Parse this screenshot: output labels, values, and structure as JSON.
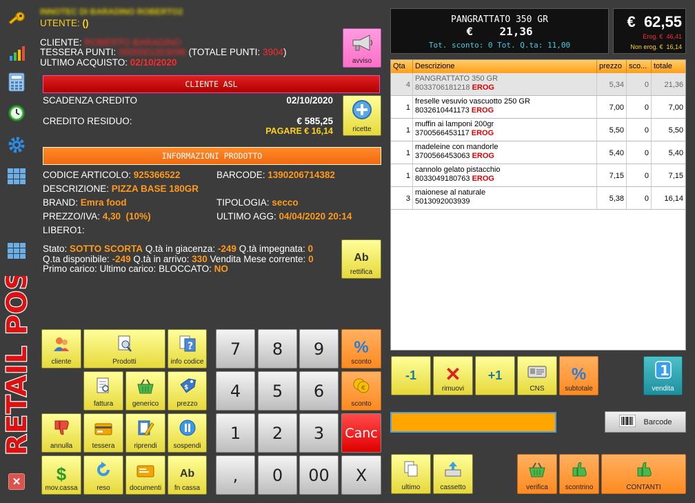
{
  "sidebar": {
    "icons": [
      "key-icon",
      "chart-icon",
      "calculator-icon",
      "clock-icon",
      "gear-icon",
      "grid-icon",
      "grid-icon"
    ],
    "logo_text": "RETAIL POS",
    "close_label": "✕"
  },
  "header": {
    "store_name": "INNOTEC DI BARADINO ROBERTO2",
    "utente_label": "UTENTE:",
    "utente_value": "()"
  },
  "customer": {
    "cliente_label": "CLIENTE:",
    "cliente_value": "ROBERTO BARADINO",
    "tessera_label": "TESSERA PUNTI:",
    "tessera_value": "0000001003096",
    "totale_punti_label": "(TOTALE PUNTI:",
    "totale_punti_value": "3904",
    "totale_punti_close": ")",
    "ultimo_acquisto_label": "ULTIMO ACQUISTO:",
    "ultimo_acquisto_value": "02/10/2020"
  },
  "avviso_button": "avviso",
  "asl_bar": "CLIENTE ASL",
  "credit": {
    "scadenza_label": "SCADENZA CREDITO",
    "scadenza_value": "02/10/2020",
    "residuo_label": "CREDITO RESIDUO:",
    "residuo_value": "€ 585,25",
    "pagare_value": "PAGARE € 16,14"
  },
  "ricette_button": "ricette",
  "product_bar": "INFORMAZIONI PRODOTTO",
  "product": {
    "codice_label": "CODICE ARTICOLO:",
    "codice_value": "925366522",
    "barcode_label": "BARCODE:",
    "barcode_value": "1390206714382",
    "descrizione_label": "DESCRIZIONE:",
    "descrizione_value": "PIZZA BASE 180GR",
    "brand_label": "BRAND:",
    "brand_value": "Emra food",
    "tipologia_label": "TIPOLOGIA:",
    "tipologia_value": "secco",
    "prezzo_label": "PREZZO/IVA:",
    "prezzo_value": "4,30  (10%)",
    "ultimo_agg_label": "ULTIMO AGG:",
    "ultimo_agg_value": "04/04/2020 20:14",
    "libero_label": "LIBERO1:"
  },
  "stock": {
    "stato_label": "Stato:",
    "stato_value": "SOTTO SCORTA",
    "giacenza_label": "Q.tà in giacenza:",
    "giacenza_value": "-249",
    "impegnata_label": "Q.tà impegnata:",
    "impegnata_value": "0",
    "disponibile_label": "Q.ta disponibile:",
    "disponibile_value": "-249",
    "arrivo_label": "Q.tà in arrivo:",
    "arrivo_value": "330",
    "vendita_label": "Vendita Mese corrente:",
    "vendita_value": "0",
    "primo_label": "Primo carico:",
    "ultimo_label": "Ultimo carico:",
    "bloccato_label": "BLOCCATO:",
    "bloccato_value": "NO"
  },
  "rettifica_button": "rettifica",
  "func_buttons": {
    "cliente": "cliente",
    "prodotti": "Prodotti",
    "info_codice": "info codice",
    "sconto1": "sconto",
    "fattura": "fattura",
    "generico": "generico",
    "prezzo": "prezzo",
    "sconto2": "sconto",
    "annulla": "annulla",
    "tessera": "tessera",
    "riprendi": "riprendi",
    "sospendi": "sospendi",
    "mov_cassa": "mov.cassa",
    "reso": "reso",
    "documenti": "documenti",
    "fn_cassa": "fn cassa",
    "sconto1_icon": "%",
    "ab_icon": "Ab"
  },
  "keypad": {
    "k7": "7",
    "k8": "8",
    "k9": "9",
    "k4": "4",
    "k5": "5",
    "k6": "6",
    "k1": "1",
    "k2": "2",
    "k3": "3",
    "canc": "Canc",
    "comma": ",",
    "k0": "0",
    "k00": "00",
    "x": "X"
  },
  "display": {
    "product": "PANGRATTATO 350 GR",
    "price": "€    21,36",
    "footer": "Tot. sconto: 0 Tot. Q.ta: 11,00"
  },
  "total": {
    "amount": "€  62,55",
    "erog_label": "Erog. €",
    "erog_value": "46,41",
    "non_erog_label": "Non erog. €",
    "non_erog_value": "16,14"
  },
  "table": {
    "headers": [
      "Qta",
      "Descrizione",
      "prezzo",
      "sco...",
      "totale"
    ],
    "rows": [
      {
        "qta": "4",
        "desc": "PANGRATTATO 350 GR",
        "code": "8033706181218",
        "tag": "EROG",
        "prezzo": "5,34",
        "sconto": "0",
        "totale": "21,36"
      },
      {
        "qta": "1",
        "desc": "freselle vesuvio vascuotto 250 GR",
        "code": "8032610441173",
        "tag": "EROG",
        "prezzo": "7,00",
        "sconto": "0",
        "totale": "7,00"
      },
      {
        "qta": "1",
        "desc": "muffin ai lamponi 200gr",
        "code": "3700566453117",
        "tag": "EROG",
        "prezzo": "5,50",
        "sconto": "0",
        "totale": "5,50"
      },
      {
        "qta": "1",
        "desc": "madeleine con mandorle",
        "code": "3700566453063",
        "tag": "EROG",
        "prezzo": "5,40",
        "sconto": "0",
        "totale": "5,40"
      },
      {
        "qta": "1",
        "desc": "cannolo gelato pistacchio",
        "code": "8033049180763",
        "tag": "EROG",
        "prezzo": "7,15",
        "sconto": "0",
        "totale": "7,15"
      },
      {
        "qta": "3",
        "desc": "maionese al naturale",
        "code": "5013092003939",
        "tag": "",
        "prezzo": "5,38",
        "sconto": "0",
        "totale": "16,14"
      }
    ]
  },
  "row_buttons": {
    "minus": "-1",
    "rimuovi": "rimuovi",
    "plus": "+1",
    "cns": "CNS",
    "subtotale": "subtotale",
    "vendita": "vendita",
    "vendita_icon": "1",
    "subtotale_icon": "%"
  },
  "barcode_input": {
    "value": ""
  },
  "barcode_button": "Barcode",
  "bottom_buttons": {
    "ultimo": "ultimo",
    "cassetto": "cassetto",
    "verifica": "verifica",
    "scontrino": "scontrino",
    "contanti": "CONTANTI"
  },
  "colors": {
    "background": "#3c3c3c",
    "accent_yellow": "#ffd21a",
    "accent_orange": "#ff9a1c",
    "accent_red": "#ff2a2a",
    "button_yellow": "#f2ea60"
  }
}
